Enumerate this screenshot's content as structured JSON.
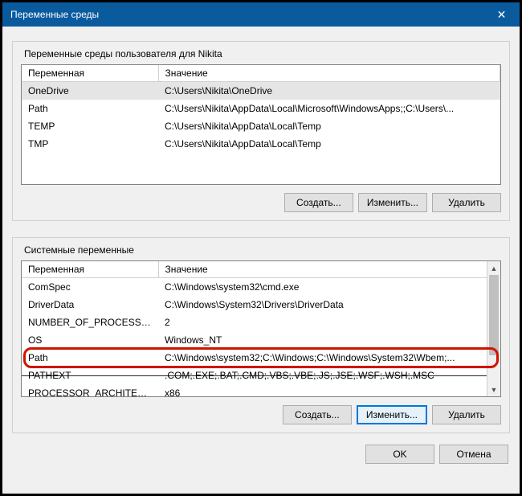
{
  "titlebar": {
    "title": "Переменные среды",
    "close": "✕"
  },
  "user_section": {
    "title": "Переменные среды пользователя для Nikita",
    "col_name": "Переменная",
    "col_value": "Значение",
    "rows": [
      {
        "name": "OneDrive",
        "value": "C:\\Users\\Nikita\\OneDrive"
      },
      {
        "name": "Path",
        "value": "C:\\Users\\Nikita\\AppData\\Local\\Microsoft\\WindowsApps;;C:\\Users\\..."
      },
      {
        "name": "TEMP",
        "value": "C:\\Users\\Nikita\\AppData\\Local\\Temp"
      },
      {
        "name": "TMP",
        "value": "C:\\Users\\Nikita\\AppData\\Local\\Temp"
      }
    ],
    "buttons": {
      "create": "Создать...",
      "edit": "Изменить...",
      "delete": "Удалить"
    }
  },
  "system_section": {
    "title": "Системные переменные",
    "col_name": "Переменная",
    "col_value": "Значение",
    "rows": [
      {
        "name": "ComSpec",
        "value": "C:\\Windows\\system32\\cmd.exe"
      },
      {
        "name": "DriverData",
        "value": "C:\\Windows\\System32\\Drivers\\DriverData"
      },
      {
        "name": "NUMBER_OF_PROCESSORS",
        "value": "2"
      },
      {
        "name": "OS",
        "value": "Windows_NT"
      },
      {
        "name": "Path",
        "value": "C:\\Windows\\system32;C:\\Windows;C:\\Windows\\System32\\Wbem;..."
      },
      {
        "name": "PATHEXT",
        "value": ".COM;.EXE;.BAT;.CMD;.VBS;.VBE;.JS;.JSE;.WSF;.WSH;.MSC"
      },
      {
        "name": "PROCESSOR_ARCHITECTURE",
        "value": "x86"
      }
    ],
    "buttons": {
      "create": "Создать...",
      "edit": "Изменить...",
      "delete": "Удалить"
    }
  },
  "dialog_buttons": {
    "ok": "OK",
    "cancel": "Отмена"
  }
}
